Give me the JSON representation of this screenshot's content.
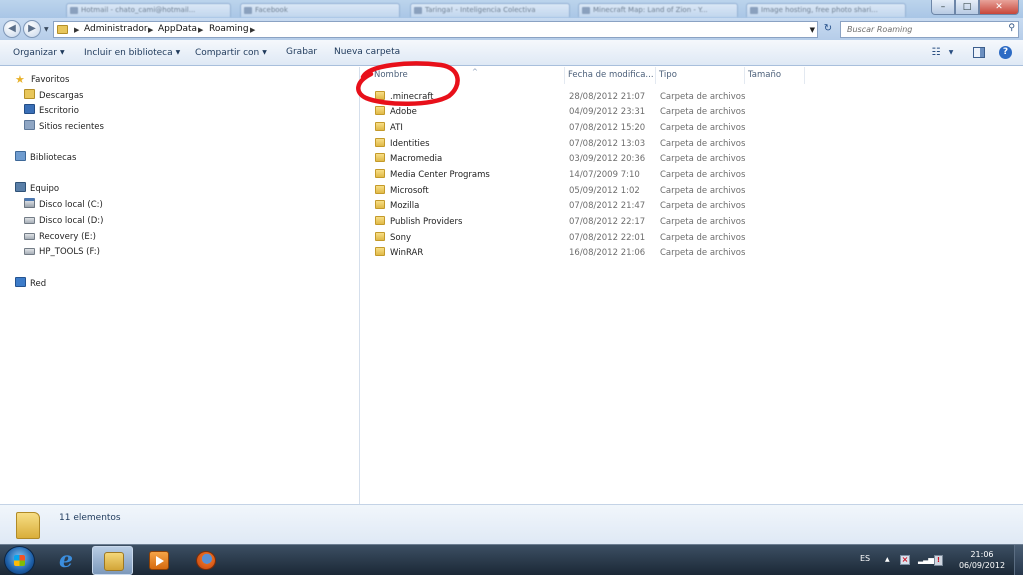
{
  "window": {
    "background_tabs": [
      "Hotmail - chato_cami@hotmail...",
      "Facebook",
      "Taringa! - Inteligencia Colectiva",
      "Minecraft Map: Land of Zion - Y...",
      "Image hosting, free photo shari..."
    ],
    "controls": {
      "minimize": "–",
      "maximize": "□",
      "close": "✕"
    }
  },
  "address": {
    "back_icon": "back-arrow-icon",
    "forward_icon": "forward-arrow-icon",
    "crumbs": [
      "Administrador",
      "AppData",
      "Roaming"
    ],
    "search_placeholder": "Buscar Roaming"
  },
  "commands": {
    "organize": "Organizar",
    "include_library": "Incluir en biblioteca",
    "share_with": "Compartir con",
    "burn": "Grabar",
    "new_folder": "Nueva carpeta"
  },
  "nav_pane": {
    "favorites": {
      "label": "Favoritos",
      "items": [
        "Descargas",
        "Escritorio",
        "Sitios recientes"
      ]
    },
    "libraries": {
      "label": "Bibliotecas"
    },
    "computer": {
      "label": "Equipo",
      "items": [
        "Disco local (C:)",
        "Disco local (D:)",
        "Recovery (E:)",
        "HP_TOOLS (F:)"
      ]
    },
    "network": {
      "label": "Red"
    }
  },
  "file_list": {
    "columns": {
      "name": "Nombre",
      "date": "Fecha de modifica...",
      "type": "Tipo",
      "size": "Tamaño"
    },
    "rows": [
      {
        "name": ".minecraft",
        "date": "28/08/2012 21:07",
        "type": "Carpeta de archivos"
      },
      {
        "name": "Adobe",
        "date": "04/09/2012 23:31",
        "type": "Carpeta de archivos"
      },
      {
        "name": "ATI",
        "date": "07/08/2012 15:20",
        "type": "Carpeta de archivos"
      },
      {
        "name": "Identities",
        "date": "07/08/2012 13:03",
        "type": "Carpeta de archivos"
      },
      {
        "name": "Macromedia",
        "date": "03/09/2012 20:36",
        "type": "Carpeta de archivos"
      },
      {
        "name": "Media Center Programs",
        "date": "14/07/2009 7:10",
        "type": "Carpeta de archivos"
      },
      {
        "name": "Microsoft",
        "date": "05/09/2012 1:02",
        "type": "Carpeta de archivos"
      },
      {
        "name": "Mozilla",
        "date": "07/08/2012 21:47",
        "type": "Carpeta de archivos"
      },
      {
        "name": "Publish Providers",
        "date": "07/08/2012 22:17",
        "type": "Carpeta de archivos"
      },
      {
        "name": "Sony",
        "date": "07/08/2012 22:01",
        "type": "Carpeta de archivos"
      },
      {
        "name": "WinRAR",
        "date": "16/08/2012 21:06",
        "type": "Carpeta de archivos"
      }
    ],
    "highlight_color": "#e8101a"
  },
  "details": {
    "count": "11 elementos"
  },
  "taskbar": {
    "language": "ES",
    "time": "21:06",
    "date": "06/09/2012"
  }
}
